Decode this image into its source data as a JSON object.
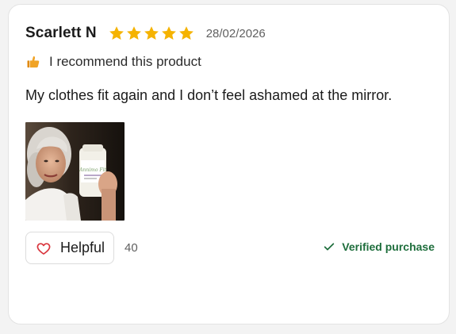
{
  "review": {
    "reviewer_name": "Scarlett N",
    "rating": 5,
    "rating_max": 5,
    "date": "28/02/2026",
    "recommend_icon": "thumbs-up-icon",
    "recommend_text": "I recommend this product",
    "text": "My clothes fit again and I don’t feel ashamed at the mirror.",
    "photo_label": "Annimo Fit"
  },
  "actions": {
    "helpful_label": "Helpful",
    "helpful_count": "40",
    "verified_label": "Verified purchase"
  },
  "colors": {
    "star": "#f5b301",
    "verified": "#1e6e3c",
    "heart": "#d9363e",
    "thumb": "#f0a326"
  }
}
